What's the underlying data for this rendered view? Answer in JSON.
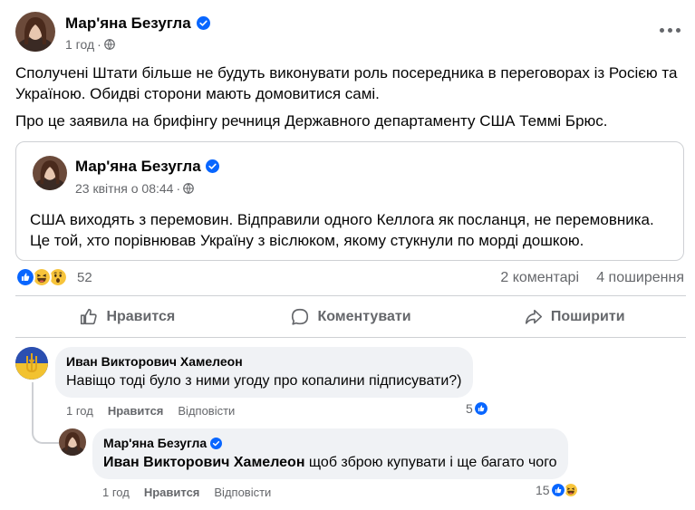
{
  "post": {
    "author": "Мар'яна Безугла",
    "time": "1 год",
    "separator": "·",
    "paragraphs": [
      "Сполучені Штати більше не будуть виконувати роль посередника в переговорах із Росією та Україною. Обидві сторони мають домовитися самі.",
      "Про це заявила на брифінгу речниця Державного департаменту США Теммі Брюс."
    ]
  },
  "shared": {
    "author": "Мар'яна Безугла",
    "time": "23 квітня о 08:44",
    "separator": "·",
    "text": "США виходять з перемовин. Відправили одного Келлога як посланця, не перемовника. Це той, хто порівнював Україну з віслюком, якому стукнули по морді дошкою."
  },
  "reactions": {
    "count": "52",
    "comments": "2 коментарі",
    "shares": "4 поширення",
    "icons": [
      "like-icon",
      "haha-icon",
      "wow-icon"
    ]
  },
  "actions": {
    "like": "Нравится",
    "comment": "Коментувати",
    "share": "Поширити"
  },
  "comments": [
    {
      "author": "Иван Викторович Хамелеон",
      "text": "Навіщо тоді було з ними угоду про копалини підписувати?)",
      "time": "1 год",
      "like": "Нравится",
      "reply": "Відповісти",
      "reaction_count": "5"
    },
    {
      "author": "Мар'яна Безугла",
      "mention": "Иван Викторович Хамелеон",
      "text": " щоб зброю купувати і ще багато чого",
      "time": "1 год",
      "like": "Нравится",
      "reply": "Відповісти",
      "reaction_count": "15"
    }
  ],
  "colors": {
    "brand_blue": "#0866ff",
    "secondary_text": "#65676b",
    "bubble_bg": "#f0f2f5",
    "divider": "#ced0d4"
  }
}
